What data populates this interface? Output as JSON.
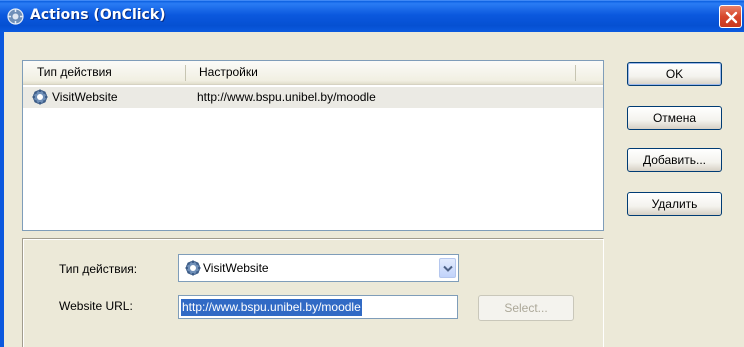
{
  "window": {
    "title": "Actions (OnClick)"
  },
  "list": {
    "columns": [
      "Тип действия",
      "Настройки"
    ],
    "rows": [
      {
        "type": "VisitWebsite",
        "settings": "http://www.bspu.unibel.by/moodle"
      }
    ]
  },
  "buttons": {
    "ok": "OK",
    "cancel": "Отмена",
    "add": "Добавить...",
    "delete": "Удалить"
  },
  "details": {
    "action_type_label": "Тип действия:",
    "action_type_value": "VisitWebsite",
    "url_label": "Website URL:",
    "url_value": "http://www.bspu.unibel.by/moodle",
    "select_label": "Select..."
  },
  "colors": {
    "titlebar": "#0b58de",
    "selection": "#316ac5",
    "close": "#d7462b"
  },
  "icons": {
    "title": "gear-globe-icon",
    "row": "gear-icon",
    "close": "close-icon",
    "dropdown": "chevron-down-icon"
  }
}
